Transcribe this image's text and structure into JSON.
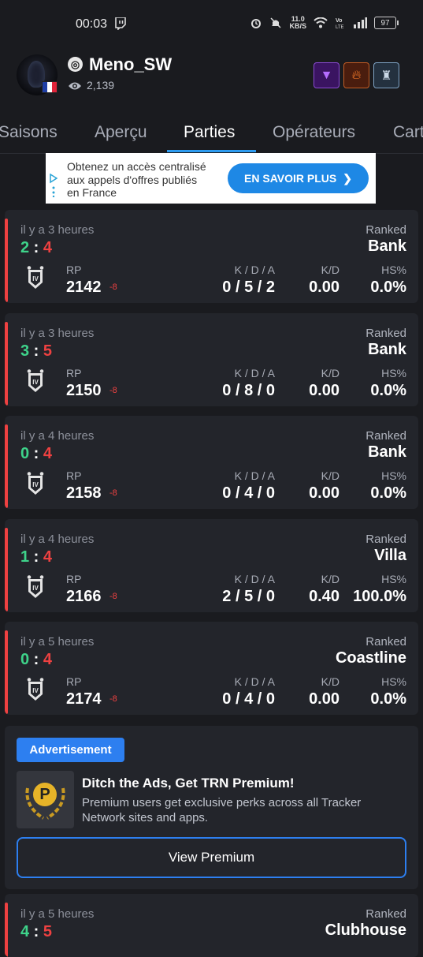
{
  "status": {
    "time": "00:03",
    "net_speed_value": "11.0",
    "net_speed_unit": "KB/S",
    "battery": "97",
    "icons": [
      "twitch-icon",
      "alarm-icon",
      "mute-icon",
      "wifi-icon",
      "volte-icon",
      "signal-icon",
      "battery-icon"
    ]
  },
  "profile": {
    "username": "Meno_SW",
    "views": "2,139",
    "flag_colors": [
      "#1f3fa6",
      "#ffffff",
      "#e0243a"
    ],
    "badges": [
      "purple-triangle-badge",
      "fire-badge",
      "warrior-badge"
    ]
  },
  "tabs": [
    {
      "label": "Saisons",
      "active": false
    },
    {
      "label": "Aperçu",
      "active": false
    },
    {
      "label": "Parties",
      "active": true
    },
    {
      "label": "Opérateurs",
      "active": false
    },
    {
      "label": "Cart",
      "active": false
    }
  ],
  "ad": {
    "text": "Obtenez un accès centralisé aux appels d'offres publiés en France",
    "button": "EN SAVOIR PLUS"
  },
  "labels": {
    "rp": "RP",
    "kda": "K / D / A",
    "kd": "K/D",
    "hs": "HS%"
  },
  "matches": [
    {
      "time": "il y a 3 heures",
      "score_win": "2",
      "score_lose": "4",
      "mode": "Ranked",
      "map": "Bank",
      "rank": "IV",
      "rp": "2142",
      "rp_delta": "-8",
      "kda": "0 / 5 / 2",
      "kd": "0.00",
      "hs": "0.0%"
    },
    {
      "time": "il y a 3 heures",
      "score_win": "3",
      "score_lose": "5",
      "mode": "Ranked",
      "map": "Bank",
      "rank": "IV",
      "rp": "2150",
      "rp_delta": "-8",
      "kda": "0 / 8 / 0",
      "kd": "0.00",
      "hs": "0.0%"
    },
    {
      "time": "il y a 4 heures",
      "score_win": "0",
      "score_lose": "4",
      "mode": "Ranked",
      "map": "Bank",
      "rank": "IV",
      "rp": "2158",
      "rp_delta": "-8",
      "kda": "0 / 4 / 0",
      "kd": "0.00",
      "hs": "0.0%"
    },
    {
      "time": "il y a 4 heures",
      "score_win": "1",
      "score_lose": "4",
      "mode": "Ranked",
      "map": "Villa",
      "rank": "IV",
      "rp": "2166",
      "rp_delta": "-8",
      "kda": "2 / 5 / 0",
      "kd": "0.40",
      "hs": "100.0%"
    },
    {
      "time": "il y a 5 heures",
      "score_win": "0",
      "score_lose": "4",
      "mode": "Ranked",
      "map": "Coastline",
      "rank": "IV",
      "rp": "2174",
      "rp_delta": "-8",
      "kda": "0 / 4 / 0",
      "kd": "0.00",
      "hs": "0.0%"
    },
    {
      "time": "il y a 5 heures",
      "score_win": "4",
      "score_lose": "5",
      "mode": "Ranked",
      "map": "Clubhouse"
    }
  ],
  "premium": {
    "badge": "Advertisement",
    "logo_letter": "P",
    "title": "Ditch the Ads, Get TRN Premium!",
    "description": "Premium users get exclusive perks across all Tracker Network sites and apps.",
    "button": "View Premium"
  },
  "colors": {
    "win": "#3ed38a",
    "loss": "#ee4141",
    "accent": "#2d9bf0",
    "card": "#23252b",
    "background": "#1a1b1f"
  }
}
